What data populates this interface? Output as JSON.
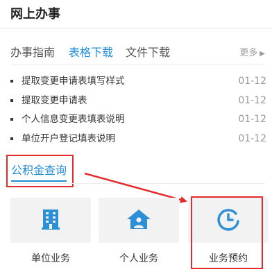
{
  "header": {
    "title": "网上办事"
  },
  "tabs": [
    {
      "label": "办事指南",
      "active": false
    },
    {
      "label": "表格下载",
      "active": true
    },
    {
      "label": "文件下载",
      "active": false
    }
  ],
  "more": {
    "label": "更多"
  },
  "list": [
    {
      "text": "提取变更申请表填写样式",
      "date": "01-12"
    },
    {
      "text": "提取变更申请表",
      "date": "01-12"
    },
    {
      "text": "个人信息变更表填表说明",
      "date": "01-12"
    },
    {
      "text": "单位开户登记填表说明",
      "date": "01-12"
    }
  ],
  "query": {
    "label": "公积金查询"
  },
  "tiles": [
    {
      "label": "单位业务",
      "icon": "building-icon"
    },
    {
      "label": "个人业务",
      "icon": "person-house-icon"
    },
    {
      "label": "业务预约",
      "icon": "clock-icon"
    }
  ],
  "colors": {
    "accent": "#1f8dd6",
    "highlight": "#e32b2b"
  }
}
